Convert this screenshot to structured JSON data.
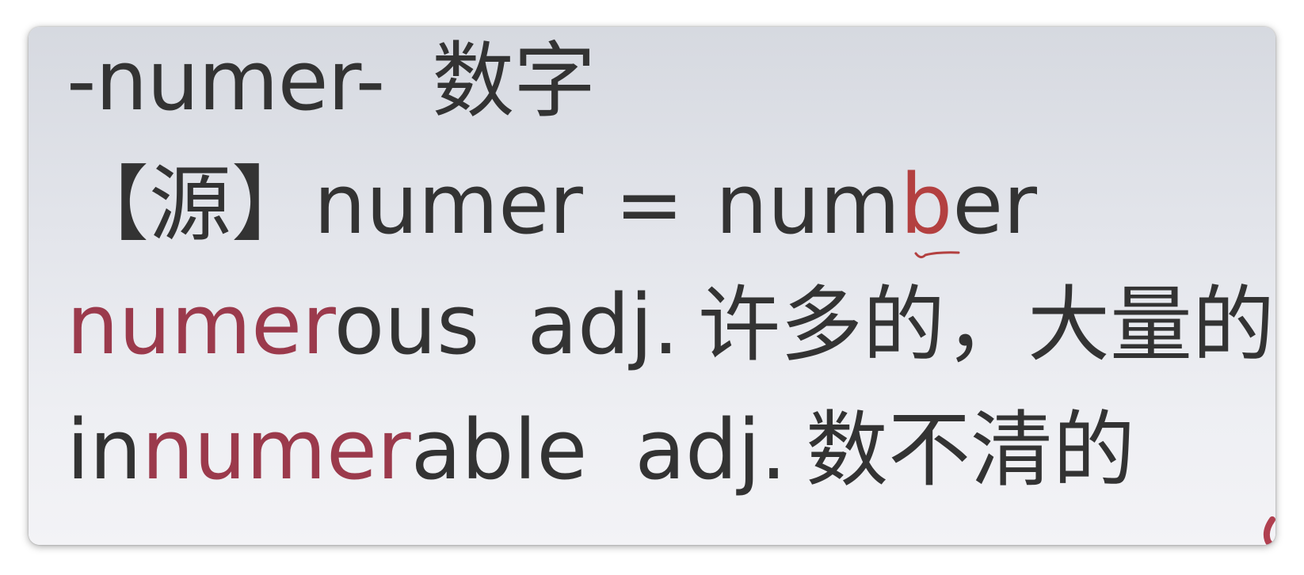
{
  "colors": {
    "text": "#333333",
    "highlight": "#9b3a4c",
    "mark": "#b34040",
    "background": "#e6e8ed"
  },
  "line1": {
    "root": "-numer-",
    "meaning": "数字"
  },
  "line2": {
    "bracket_open": "【",
    "source_label": "源",
    "bracket_close": "】",
    "left": "numer",
    "equals": "=",
    "right_before": "num",
    "right_mark": "b",
    "right_after": "er"
  },
  "line3": {
    "word_root": "numer",
    "word_rest": "ous",
    "pos": "adj.",
    "meaning": "许多的，大量的"
  },
  "line4": {
    "word_prefix": "in",
    "word_root": "numer",
    "word_rest": "able",
    "pos": "adj.",
    "meaning": "数不清的"
  }
}
